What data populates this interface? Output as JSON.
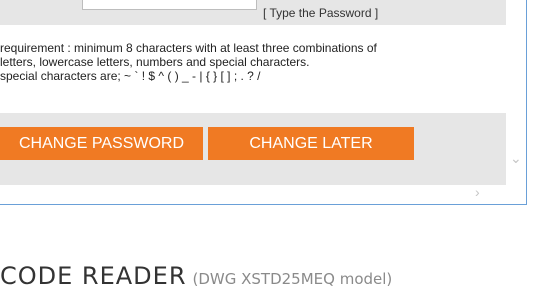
{
  "confirm_password": {
    "value": "",
    "hint": "[ Type the Password ]"
  },
  "requirements": {
    "lines": [
      "requirement : minimum 8 characters with at least three combinations of",
      "letters, lowercase letters, numbers and special characters.",
      " special characters are; ~ ` ! $ ^ ( ) _ - | { } [ ] ; . ? /"
    ]
  },
  "buttons": {
    "change_password": "CHANGE PASSWORD",
    "change_later": "CHANGE LATER"
  },
  "icons": {
    "scroll_down": "chevron-down-icon",
    "scroll_right": "chevron-right-icon"
  },
  "colors": {
    "button_bg": "#f07a23",
    "band_bg": "#e6e6e6",
    "frame_border": "#6aa0d8"
  },
  "page": {
    "title_main": "CODE READER",
    "title_sub": "(DWG XSTD25MEQ model)"
  }
}
